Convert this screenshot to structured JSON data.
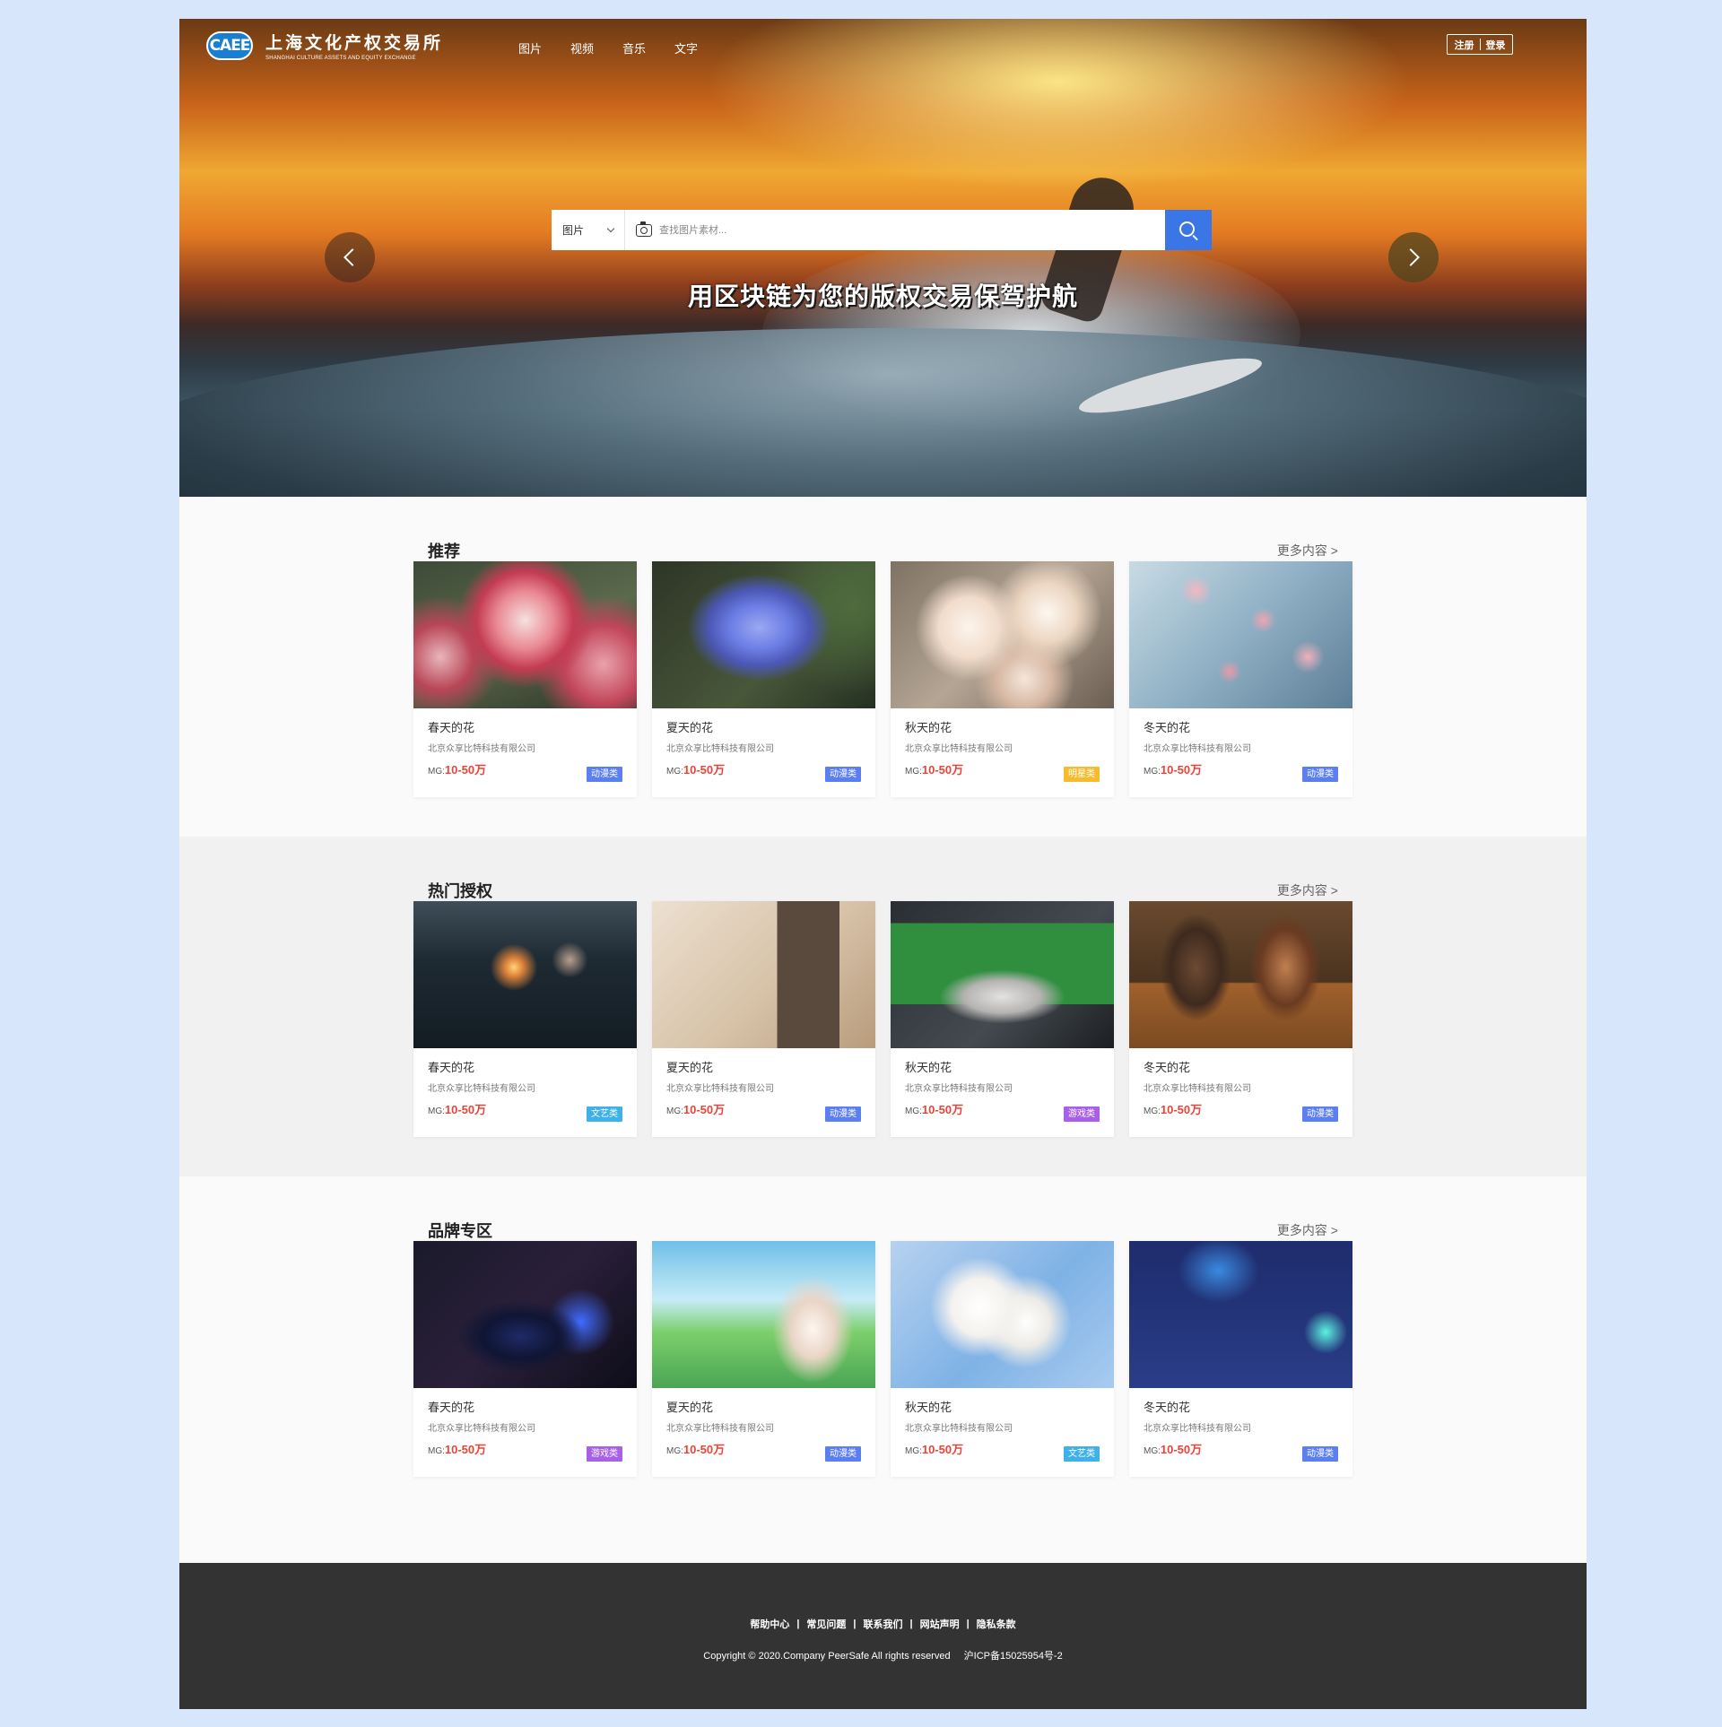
{
  "header": {
    "logo_badge": "CAEE",
    "logo_cn": "上海文化产权交易所",
    "logo_en": "SHANGHAI CULTURE ASSETS AND EQUITY EXCHANGE",
    "nav": [
      "图片",
      "视频",
      "音乐",
      "文字"
    ],
    "register": "注册",
    "login": "登录"
  },
  "hero": {
    "search_category": "图片",
    "search_placeholder": "查找图片素材...",
    "slogan": "用区块链为您的版权交易保驾护航"
  },
  "colors": {
    "accent": "#3b76e6",
    "price": "#e8443a",
    "tag_anime": "#5b7ef0",
    "tag_star": "#f6bb2e",
    "tag_art": "#3fb0e8",
    "tag_game": "#a860e8"
  },
  "sections": [
    {
      "title": "推荐",
      "more": "更多内容 >",
      "cards": [
        {
          "title": "春天的花",
          "company": "北京众享比特科技有限公司",
          "price_label": "MG:",
          "price": "10-50万",
          "tag": "动漫类",
          "tag_color": "#5b7ef0",
          "image": "rose"
        },
        {
          "title": "夏天的花",
          "company": "北京众享比特科技有限公司",
          "price_label": "MG:",
          "price": "10-50万",
          "tag": "动漫类",
          "tag_color": "#5b7ef0",
          "image": "hydrangea"
        },
        {
          "title": "秋天的花",
          "company": "北京众享比特科技有限公司",
          "price_label": "MG:",
          "price": "10-50万",
          "tag": "明星类",
          "tag_color": "#f6bb2e",
          "image": "blossom"
        },
        {
          "title": "冬天的花",
          "company": "北京众享比特科技有限公司",
          "price_label": "MG:",
          "price": "10-50万",
          "tag": "动漫类",
          "tag_color": "#5b7ef0",
          "image": "plum"
        }
      ]
    },
    {
      "title": "热门授权",
      "more": "更多内容 >",
      "cards": [
        {
          "title": "春天的花",
          "company": "北京众享比特科技有限公司",
          "price_label": "MG:",
          "price": "10-50万",
          "tag": "文艺类",
          "tag_color": "#3fb0e8",
          "image": "sparkler"
        },
        {
          "title": "夏天的花",
          "company": "北京众享比特科技有限公司",
          "price_label": "MG:",
          "price": "10-50万",
          "tag": "动漫类",
          "tag_color": "#5b7ef0",
          "image": "box"
        },
        {
          "title": "秋天的花",
          "company": "北京众享比特科技有限公司",
          "price_label": "MG:",
          "price": "10-50万",
          "tag": "游戏类",
          "tag_color": "#a860e8",
          "image": "gamepad"
        },
        {
          "title": "冬天的花",
          "company": "北京众享比特科技有限公司",
          "price_label": "MG:",
          "price": "10-50万",
          "tag": "动漫类",
          "tag_color": "#5b7ef0",
          "image": "figures"
        }
      ]
    },
    {
      "title": "品牌专区",
      "more": "更多内容 >",
      "cards": [
        {
          "title": "春天的花",
          "company": "北京众享比特科技有限公司",
          "price_label": "MG:",
          "price": "10-50万",
          "tag": "游戏类",
          "tag_color": "#a860e8",
          "image": "mouse"
        },
        {
          "title": "夏天的花",
          "company": "北京众享比特科技有限公司",
          "price_label": "MG:",
          "price": "10-50万",
          "tag": "动漫类",
          "tag_color": "#5b7ef0",
          "image": "anime"
        },
        {
          "title": "秋天的花",
          "company": "北京众享比特科技有限公司",
          "price_label": "MG:",
          "price": "10-50万",
          "tag": "文艺类",
          "tag_color": "#3fb0e8",
          "image": "pear"
        },
        {
          "title": "冬天的花",
          "company": "北京众享比特科技有限公司",
          "price_label": "MG:",
          "price": "10-50万",
          "tag": "动漫类",
          "tag_color": "#5b7ef0",
          "image": "room"
        }
      ]
    }
  ],
  "footer": {
    "links": [
      "帮助中心",
      "常见问题",
      "联系我们",
      "网站声明",
      "隐私条款"
    ],
    "separator": "|",
    "copyright": "Copyright © 2020.Company PeerSafe All rights reserved",
    "icp": "沪ICP备15025954号-2"
  }
}
